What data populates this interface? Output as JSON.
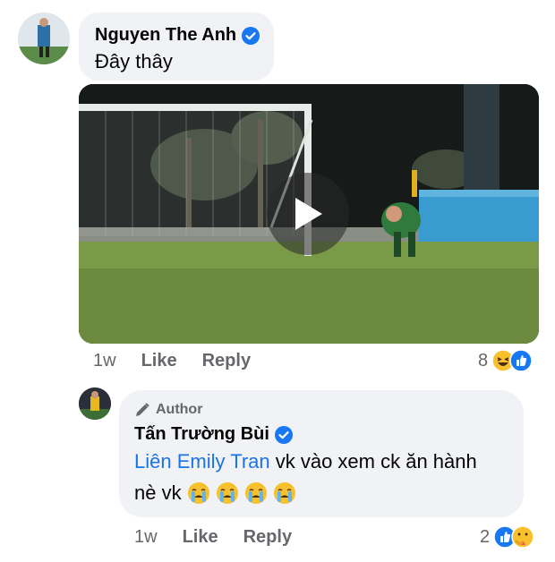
{
  "comment1": {
    "author": "Nguyen The Anh",
    "text": "Đây thây",
    "time": "1w",
    "like_label": "Like",
    "reply_label": "Reply",
    "reaction_count": "8"
  },
  "reply1": {
    "badge": "Author",
    "author": "Tấn Trường Bùi",
    "mention": "Liên Emily Tran",
    "text_line1": " vk vào xem ck ăn hành",
    "text_line2": "nè vk",
    "time": "1w",
    "like_label": "Like",
    "reply_label": "Reply",
    "reaction_count": "2"
  },
  "colors": {
    "verified": "#1877f2",
    "mention": "#1b74e4",
    "bubble": "#f0f2f5",
    "meta": "#65676b"
  }
}
